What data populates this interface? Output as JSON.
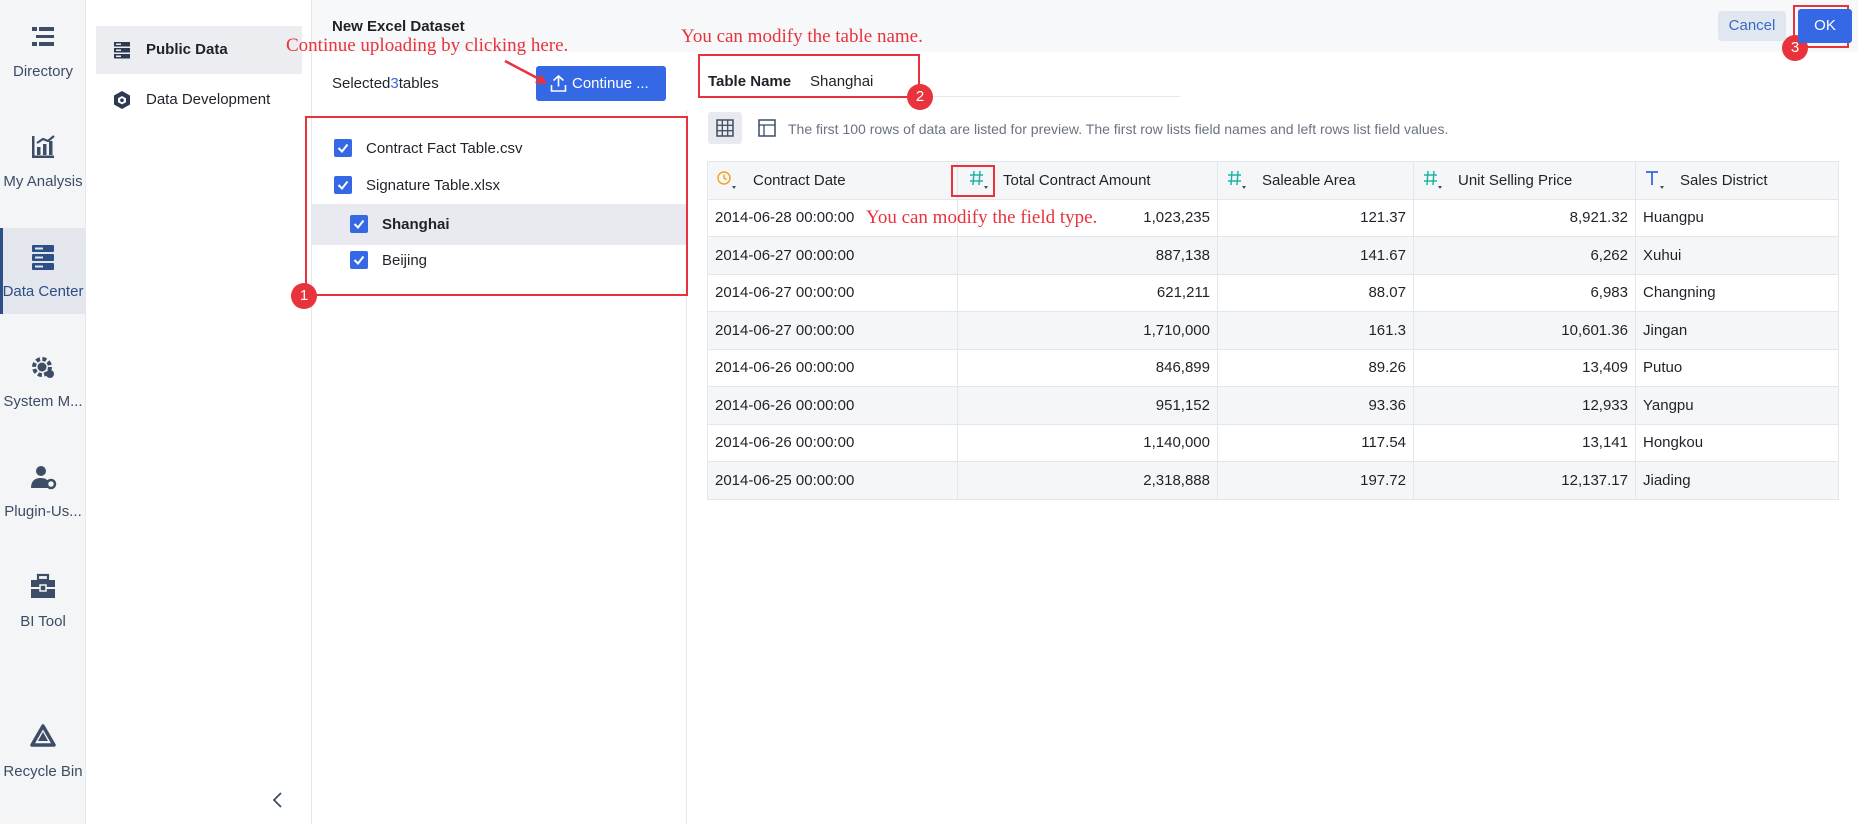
{
  "rail": {
    "items": [
      {
        "label": "Directory",
        "icon": "directory-icon"
      },
      {
        "label": "My Analysis",
        "icon": "chart-icon"
      },
      {
        "label": "Data Center",
        "icon": "database-icon",
        "active": true
      },
      {
        "label": "System M...",
        "icon": "gear-icon"
      },
      {
        "label": "Plugin-Us...",
        "icon": "user-gear-icon"
      },
      {
        "label": "BI Tool",
        "icon": "toolbox-icon"
      },
      {
        "label": "Recycle Bin",
        "icon": "recycle-icon"
      }
    ]
  },
  "panel2": {
    "items": [
      {
        "label": "Public Data",
        "icon": "public-data-icon",
        "active": true
      },
      {
        "label": "Data Development",
        "icon": "cube-icon"
      }
    ]
  },
  "dialog": {
    "title": "New Excel Dataset",
    "cancel_label": "Cancel",
    "ok_label": "OK"
  },
  "selection": {
    "prefix": "Selected",
    "count": "3",
    "suffix": "tables",
    "continue_label": "Continue ..."
  },
  "table_list": [
    {
      "label": "Contract Fact Table.csv",
      "checked": true
    },
    {
      "label": "Signature Table.xlsx",
      "checked": true
    },
    {
      "label": "Shanghai",
      "checked": true,
      "active": true
    },
    {
      "label": "Beijing",
      "checked": true
    }
  ],
  "table_name": {
    "label": "Table Name",
    "value": "Shanghai"
  },
  "preview_note": "The first 100 rows of data are listed for preview. The first row lists field names and left rows list field values.",
  "grid": {
    "columns": [
      {
        "label": "Contract Date",
        "type": "date"
      },
      {
        "label": "Total Contract Amount",
        "type": "number"
      },
      {
        "label": "Saleable Area",
        "type": "number"
      },
      {
        "label": "Unit Selling Price",
        "type": "number"
      },
      {
        "label": "Sales District",
        "type": "text"
      }
    ],
    "rows": [
      [
        "2014-06-28 00:00:00",
        "1,023,235",
        "121.37",
        "8,921.32",
        "Huangpu"
      ],
      [
        "2014-06-27 00:00:00",
        "887,138",
        "141.67",
        "6,262",
        "Xuhui"
      ],
      [
        "2014-06-27 00:00:00",
        "621,211",
        "88.07",
        "6,983",
        "Changning"
      ],
      [
        "2014-06-27 00:00:00",
        "1,710,000",
        "161.3",
        "10,601.36",
        "Jingan"
      ],
      [
        "2014-06-26 00:00:00",
        "846,899",
        "89.26",
        "13,409",
        "Putuo"
      ],
      [
        "2014-06-26 00:00:00",
        "951,152",
        "93.36",
        "12,933",
        "Yangpu"
      ],
      [
        "2014-06-26 00:00:00",
        "1,140,000",
        "117.54",
        "13,141",
        "Hongkou"
      ],
      [
        "2014-06-25 00:00:00",
        "2,318,888",
        "197.72",
        "12,137.17",
        "Jiading"
      ]
    ]
  },
  "annotations": {
    "upload_hint": "Continue uploading by clicking here.",
    "table_name_hint": "You can modify the table name.",
    "field_type_hint": "You can modify the field type.",
    "badge1": "1",
    "badge2": "2",
    "badge3": "3"
  },
  "colors": {
    "accent": "#3568e4",
    "annotation": "#e8323c",
    "date_icon": "#f0a020",
    "number_icon": "#1fb5a4",
    "text_icon": "#3568e4"
  }
}
